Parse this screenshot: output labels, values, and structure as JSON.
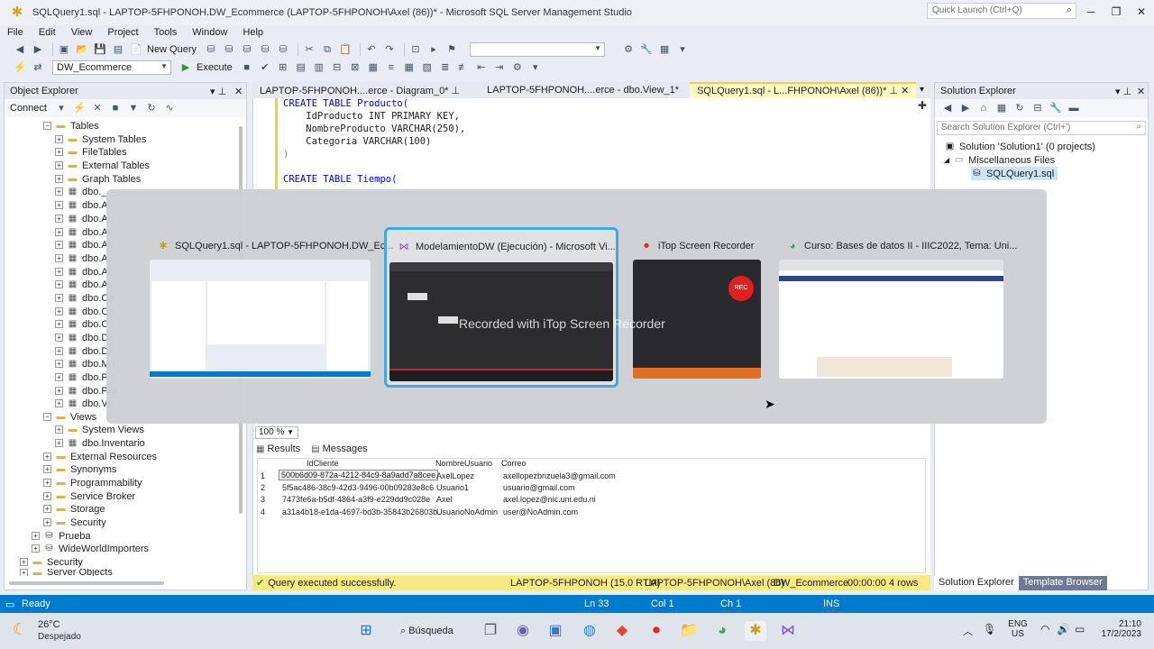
{
  "window": {
    "title": "SQLQuery1.sql - LAPTOP-5FHPONOH.DW_Ecommerce (LAPTOP-5FHPONOH\\Axel (86))* - Microsoft SQL Server Management Studio",
    "quick_launch_placeholder": "Quick Launch (Ctrl+Q)"
  },
  "menu": [
    "File",
    "Edit",
    "View",
    "Project",
    "Tools",
    "Window",
    "Help"
  ],
  "toolbar": {
    "new_query": "New Query",
    "database": "DW_Ecommerce",
    "execute": "Execute"
  },
  "object_explorer": {
    "title": "Object Explorer",
    "connect": "Connect",
    "tree": [
      "Tables",
      "System Tables",
      "FileTables",
      "External Tables",
      "Graph Tables",
      "dbo._",
      "dbo.As",
      "dbo.As",
      "dbo.As",
      "dbo.As",
      "dbo.As",
      "dbo.As",
      "dbo.As",
      "dbo.Ca",
      "dbo.Ca",
      "dbo.Co",
      "dbo.De",
      "dbo.De",
      "dbo.Me",
      "dbo.Pro",
      "dbo.Pro",
      "dbo.Ve",
      "Views",
      "System Views",
      "dbo.Inventario",
      "External Resources",
      "Synonyms",
      "Programmability",
      "Service Broker",
      "Storage",
      "Security",
      "Prueba",
      "WideWorldImporters",
      "Security",
      "Server Objects"
    ]
  },
  "editor": {
    "tabs": [
      "LAPTOP-5FHPONOH....erce - Diagram_0*",
      "LAPTOP-5FHPONOH....erce - dbo.View_1*",
      "SQLQuery1.sql - L...FHPONOH\\Axel (86))*"
    ],
    "code": [
      "CREATE TABLE Producto(",
      "    IdProducto INT PRIMARY KEY,",
      "    NombreProducto VARCHAR(250),",
      "    Categoria VARCHAR(100)",
      ")",
      "",
      "CREATE TABLE Tiempo("
    ],
    "zoom": "100 %"
  },
  "results": {
    "tabs": [
      "Results",
      "Messages"
    ],
    "columns": [
      "IdCliente",
      "NombreUsuario",
      "Correo"
    ],
    "rows": [
      [
        "1",
        "500b6d09-872a-4212-84c9-8a9add7a8cee",
        "AxelLopez",
        "axellopezbrizuela3@gmail.com"
      ],
      [
        "2",
        "5f5ac486-38c9-42d3-9496-00b09283e8c6",
        "Usuario1",
        "usuario@gmail.com"
      ],
      [
        "3",
        "7473fe6a-b5df-4864-a3f9-e229dd9c028e",
        "Axel",
        "axel.lopez@nic.uni.edu.ni"
      ],
      [
        "4",
        "a31a4b18-e1da-4697-bd3b-35843b26803b",
        "UsuarioNoAdmin",
        "user@NoAdmin.com"
      ]
    ]
  },
  "query_status": {
    "message": "Query executed successfully.",
    "server": "LAPTOP-5FHPONOH (15.0 RTM)",
    "user": "LAPTOP-5FHPONOH\\Axel (86)",
    "database": "DW_Ecommerce",
    "time": "00:00:00",
    "rows": "4 rows"
  },
  "solution_explorer": {
    "title": "Solution Explorer",
    "search_placeholder": "Search Solution Explorer (Ctrl+')",
    "solution": "Solution 'Solution1' (0 projects)",
    "folder": "Miscellaneous Files",
    "file": "SQLQuery1.sql",
    "bottom_tabs": [
      "Solution Explorer",
      "Template Browser"
    ]
  },
  "statusbar": {
    "ready": "Ready",
    "ln": "Ln 33",
    "col": "Col 1",
    "ch": "Ch 1",
    "ins": "INS"
  },
  "switcher": {
    "windows": [
      "SQLQuery1.sql - LAPTOP-5FHPONOH.DW_Ec...",
      "ModelamientoDW (Ejecución) - Microsoft Vi...",
      "iTop Screen Recorder",
      "Curso: Bases de datos II - IIIC2022, Tema: Uni..."
    ],
    "rec_label": "REC",
    "watermark": "Recorded with iTop Screen Recorder"
  },
  "taskbar": {
    "weather_temp": "26°C",
    "weather_desc": "Despejado",
    "search": "Búsqueda",
    "lang1": "ENG",
    "lang2": "US",
    "time": "21:10",
    "date": "17/2/2023"
  },
  "colors": {
    "accent": "#007acc",
    "tab_active": "#fef8c4",
    "query_status_bg": "#f7e983",
    "switcher_selection": "#3fa9e8",
    "rec": "#e02020"
  }
}
